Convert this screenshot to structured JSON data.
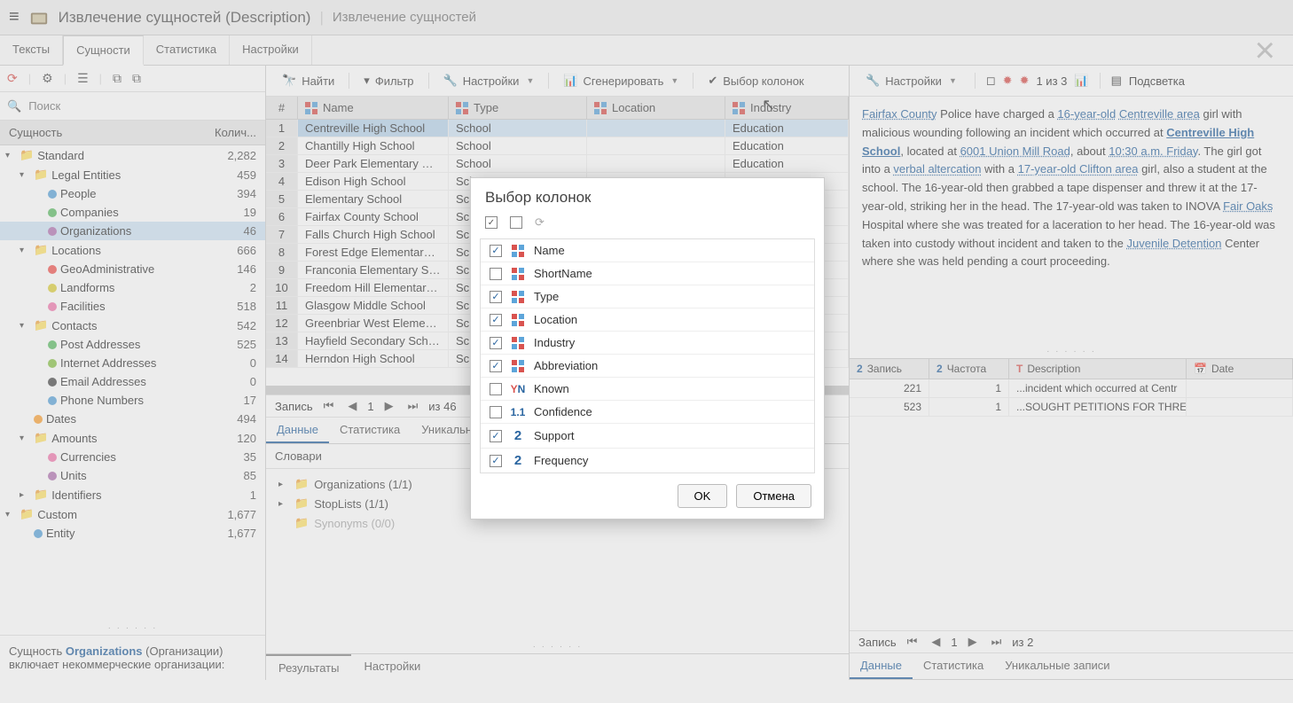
{
  "header": {
    "title": "Извлечение сущностей (Description)",
    "subtitle": "Извлечение сущностей"
  },
  "tabs": [
    "Тексты",
    "Сущности",
    "Статистика",
    "Настройки"
  ],
  "active_tab_index": 1,
  "sidebar": {
    "search_placeholder": "Поиск",
    "header_label": "Сущность",
    "header_count": "Колич...",
    "footer_line1_a": "Сущность ",
    "footer_line1_b": "Organizations",
    "footer_line1_c": " (Организации) включает некоммерческие организации:",
    "tree": [
      {
        "indent": 0,
        "exp": "▾",
        "ic": "folder",
        "label": "Standard",
        "count": "2,282"
      },
      {
        "indent": 1,
        "exp": "▾",
        "ic": "folder",
        "label": "Legal Entities",
        "count": "459"
      },
      {
        "indent": 2,
        "exp": "",
        "ic": "dot",
        "color": "#5DA5DA",
        "label": "People",
        "count": "394"
      },
      {
        "indent": 2,
        "exp": "",
        "ic": "dot",
        "color": "#60BD68",
        "label": "Companies",
        "count": "19"
      },
      {
        "indent": 2,
        "exp": "",
        "ic": "dot",
        "color": "#B276B2",
        "label": "Organizations",
        "count": "46",
        "selected": true
      },
      {
        "indent": 1,
        "exp": "▾",
        "ic": "folder",
        "label": "Locations",
        "count": "666"
      },
      {
        "indent": 2,
        "exp": "",
        "ic": "dot",
        "color": "#F15854",
        "label": "GeoAdministrative",
        "count": "146"
      },
      {
        "indent": 2,
        "exp": "",
        "ic": "dot",
        "color": "#DECF3F",
        "label": "Landforms",
        "count": "2"
      },
      {
        "indent": 2,
        "exp": "",
        "ic": "dot",
        "color": "#F17CB0",
        "label": "Facilities",
        "count": "518"
      },
      {
        "indent": 1,
        "exp": "▾",
        "ic": "folder",
        "label": "Contacts",
        "count": "542"
      },
      {
        "indent": 2,
        "exp": "",
        "ic": "dot",
        "color": "#60BD68",
        "label": "Post Addresses",
        "count": "525"
      },
      {
        "indent": 2,
        "exp": "",
        "ic": "dot",
        "color": "#8BC34A",
        "label": "Internet Addresses",
        "count": "0"
      },
      {
        "indent": 2,
        "exp": "",
        "ic": "dot",
        "color": "#4D4D4D",
        "label": "Email Addresses",
        "count": "0"
      },
      {
        "indent": 2,
        "exp": "",
        "ic": "dot",
        "color": "#5DA5DA",
        "label": "Phone Numbers",
        "count": "17"
      },
      {
        "indent": 1,
        "exp": "",
        "ic": "dot",
        "color": "#FAA43A",
        "label": "Dates",
        "count": "494"
      },
      {
        "indent": 1,
        "exp": "▾",
        "ic": "folder",
        "label": "Amounts",
        "count": "120"
      },
      {
        "indent": 2,
        "exp": "",
        "ic": "dot",
        "color": "#F17CB0",
        "label": "Currencies",
        "count": "35"
      },
      {
        "indent": 2,
        "exp": "",
        "ic": "dot",
        "color": "#B276B2",
        "label": "Units",
        "count": "85"
      },
      {
        "indent": 1,
        "exp": "▸",
        "ic": "folder",
        "label": "Identifiers",
        "count": "1"
      },
      {
        "indent": 0,
        "exp": "▾",
        "ic": "folder",
        "label": "Custom",
        "count": "1,677"
      },
      {
        "indent": 1,
        "exp": "",
        "ic": "dot",
        "color": "#5DA5DA",
        "label": "Entity",
        "count": "1,677"
      }
    ]
  },
  "center": {
    "toolbar": {
      "find": "Найти",
      "filter": "Фильтр",
      "settings": "Настройки",
      "generate": "Сгенерировать",
      "choose_cols": "Выбор колонок"
    },
    "columns": {
      "num": "#",
      "name": "Name",
      "type": "Type",
      "loc": "Location",
      "ind": "Industry"
    },
    "rows": [
      {
        "n": "1",
        "name": "Centreville High School",
        "type": "School",
        "loc": "",
        "ind": "Education"
      },
      {
        "n": "2",
        "name": "Chantilly High School",
        "type": "School",
        "loc": "",
        "ind": "Education"
      },
      {
        "n": "3",
        "name": "Deer Park Elementary School",
        "type": "School",
        "loc": "",
        "ind": "Education"
      },
      {
        "n": "4",
        "name": "Edison High School",
        "type": "Sch",
        "loc": "",
        "ind": ""
      },
      {
        "n": "5",
        "name": "Elementary School",
        "type": "Sch",
        "loc": "",
        "ind": ""
      },
      {
        "n": "6",
        "name": "Fairfax County School",
        "type": "Sch",
        "loc": "",
        "ind": ""
      },
      {
        "n": "7",
        "name": "Falls Church High School",
        "type": "Sch",
        "loc": "",
        "ind": ""
      },
      {
        "n": "8",
        "name": "Forest Edge Elementary Sch",
        "type": "Sch",
        "loc": "",
        "ind": ""
      },
      {
        "n": "9",
        "name": "Franconia Elementary Scho",
        "type": "Sch",
        "loc": "",
        "ind": ""
      },
      {
        "n": "10",
        "name": "Freedom Hill Elementary Sc",
        "type": "Sch",
        "loc": "",
        "ind": ""
      },
      {
        "n": "11",
        "name": "Glasgow Middle School",
        "type": "Sch",
        "loc": "",
        "ind": ""
      },
      {
        "n": "12",
        "name": "Greenbriar West Elementar",
        "type": "Sch",
        "loc": "",
        "ind": ""
      },
      {
        "n": "13",
        "name": "Hayfield Secondary School",
        "type": "Sch",
        "loc": "",
        "ind": ""
      },
      {
        "n": "14",
        "name": "Herndon High School",
        "type": "Sch",
        "loc": "",
        "ind": ""
      }
    ],
    "paginator": {
      "label": "Запись",
      "page": "1",
      "of": "из 46"
    },
    "subtabs": [
      "Данные",
      "Статистика",
      "Уникальн"
    ],
    "dict_label": "Словари",
    "dicts": [
      {
        "exp": "▸",
        "label": "Organizations (1/1)",
        "muted": false
      },
      {
        "exp": "▸",
        "label": "StopLists (1/1)",
        "muted": false
      },
      {
        "exp": "",
        "label": "Synonyms (0/0)",
        "muted": true
      }
    ],
    "bottom_tabs": [
      "Результаты",
      "Настройки"
    ]
  },
  "right": {
    "toolbar": {
      "settings": "Настройки",
      "counter": "1 из 3",
      "highlight": "Подсветка"
    },
    "grid": {
      "cols": {
        "rec": "Запись",
        "freq": "Частота",
        "desc": "Description",
        "date": "Date"
      },
      "rows": [
        {
          "rec": "221",
          "freq": "1",
          "desc": "...incident which occurred at Centr",
          "date": ""
        },
        {
          "rec": "523",
          "freq": "1",
          "desc": "...SOUGHT PETITIONS FOR THREE (",
          "date": ""
        }
      ]
    },
    "paginator": {
      "label": "Запись",
      "page": "1",
      "of": "из 2"
    },
    "subtabs": [
      "Данные",
      "Статистика",
      "Уникальные записи"
    ]
  },
  "modal": {
    "title": "Выбор колонок",
    "ok": "OK",
    "cancel": "Отмена",
    "columns": [
      {
        "checked": true,
        "ic": "grid",
        "name": "Name"
      },
      {
        "checked": false,
        "ic": "grid",
        "name": "ShortName"
      },
      {
        "checked": true,
        "ic": "grid",
        "name": "Type"
      },
      {
        "checked": true,
        "ic": "grid",
        "name": "Location"
      },
      {
        "checked": true,
        "ic": "grid",
        "name": "Industry"
      },
      {
        "checked": true,
        "ic": "grid",
        "name": "Abbreviation"
      },
      {
        "checked": false,
        "ic": "yn",
        "name": "Known"
      },
      {
        "checked": false,
        "ic": "dec",
        "name": "Confidence"
      },
      {
        "checked": true,
        "ic": "int",
        "name": "Support"
      },
      {
        "checked": true,
        "ic": "int",
        "name": "Frequency"
      }
    ]
  }
}
